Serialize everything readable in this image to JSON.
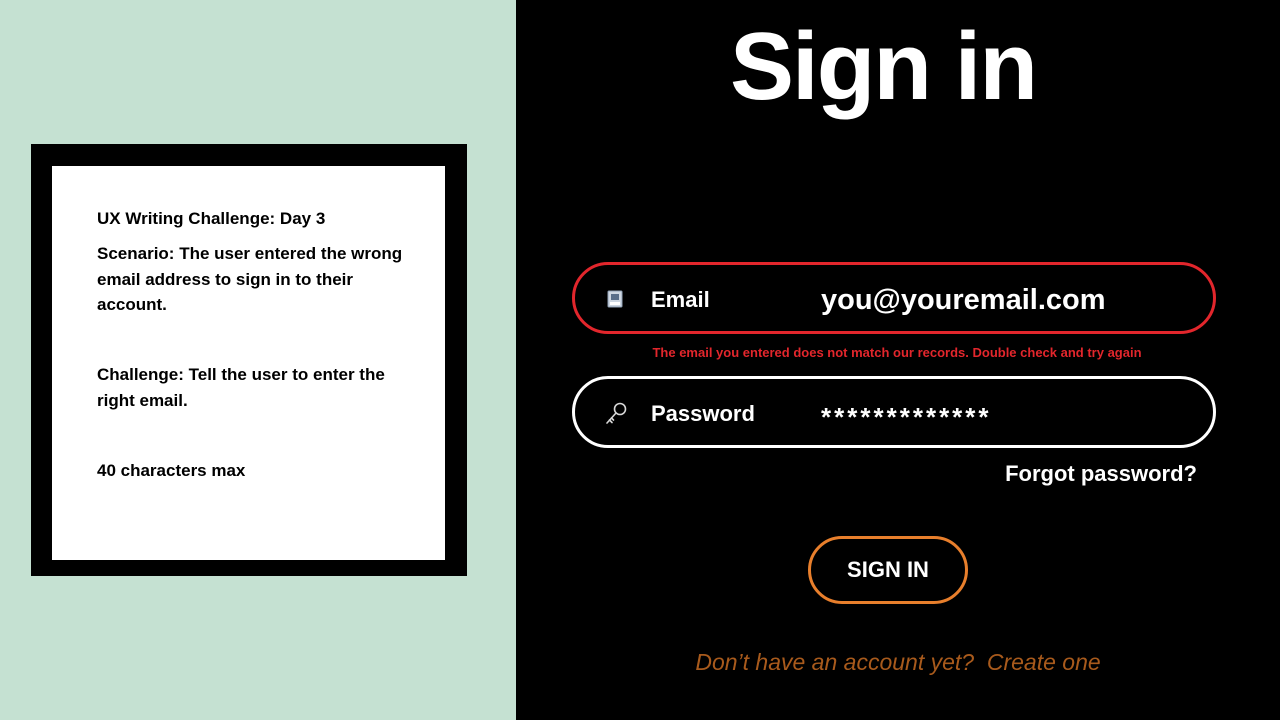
{
  "challenge_card": {
    "title": "UX Writing Challenge: Day 3",
    "scenario": "Scenario: The user entered the wrong email address to sign in to their account.",
    "challenge": "Challenge: Tell the user to enter the right email.",
    "limit": "40 characters max"
  },
  "signin": {
    "title": "Sign in",
    "email": {
      "label": "Email",
      "value": "you@youremail.com",
      "icon": "envelope-icon",
      "error": "The email you entered does not match our records. Double check and try again"
    },
    "password": {
      "label": "Password",
      "value": "*************",
      "icon": "key-icon"
    },
    "forgot_label": "Forgot password?",
    "button_label": "SIGN IN",
    "footer_prompt": "Don’t have an account yet?",
    "footer_link": "Create one"
  },
  "colors": {
    "left_bg": "#c5e1d2",
    "error_red": "#e2262c",
    "button_orange": "#e87f2c",
    "footer_orange": "#a85a1c"
  }
}
